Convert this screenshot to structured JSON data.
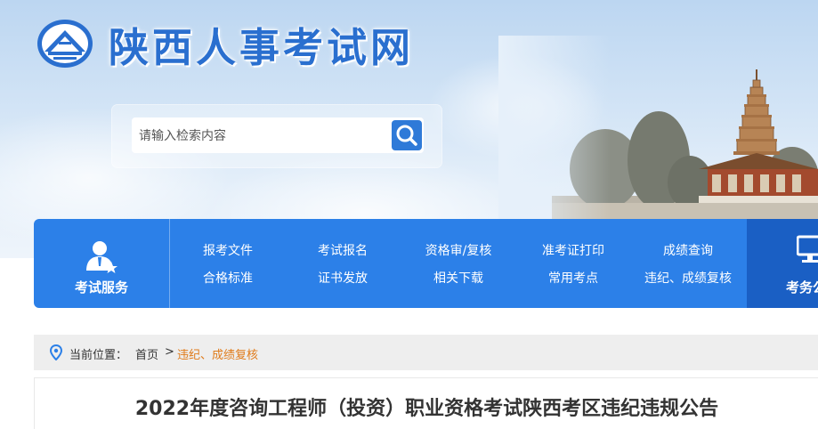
{
  "header": {
    "site_title": "陕西人事考试网"
  },
  "search": {
    "placeholder": "请输入检索内容"
  },
  "nav": {
    "service_label": "考试服务",
    "right_label": "考务公",
    "links": [
      "报考文件",
      "考试报名",
      "资格审/复核",
      "准考证打印",
      "成绩查询",
      "合格标准",
      "证书发放",
      "相关下载",
      "常用考点",
      "违纪、成绩复核"
    ]
  },
  "breadcrumb": {
    "prefix": "当前位置：",
    "home": "首页",
    "separator": ">",
    "current": "违纪、成绩复核"
  },
  "article": {
    "title": "2022年度咨询工程师（投资）职业资格考试陕西考区违纪违规公告"
  },
  "colors": {
    "nav_blue": "#2c80e8",
    "title_blue": "#2a6fcf",
    "breadcrumb_current": "#e07b1a"
  }
}
